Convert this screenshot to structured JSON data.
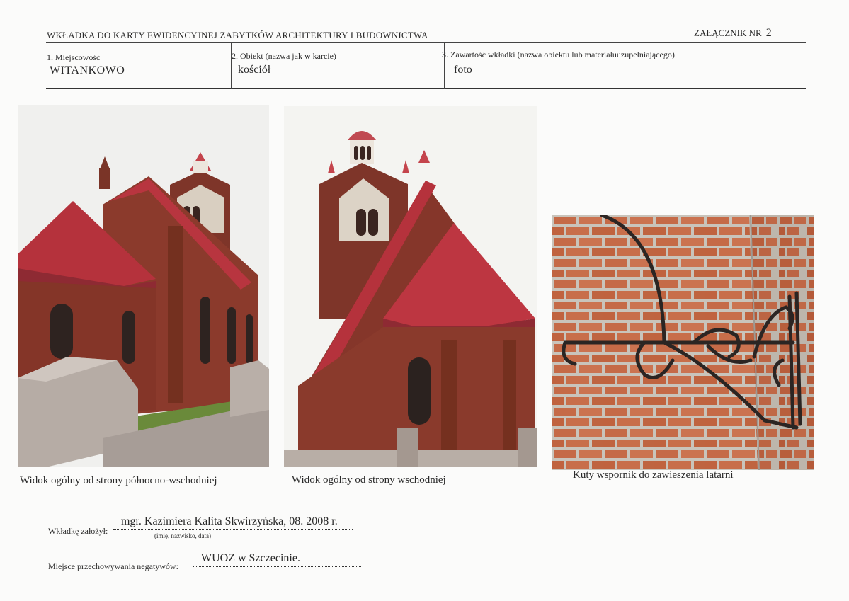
{
  "header": {
    "title": "WKŁADKA DO KARTY EWIDENCYJNEJ ZABYTKÓW ARCHITEKTURY I BUDOWNICTWA",
    "annex_label": "ZAŁĄCZNIK NR",
    "annex_number": "2"
  },
  "fields": [
    {
      "label": "1. Miejscowość",
      "value": "WITANKOWO"
    },
    {
      "label": "2. Obiekt (nazwa jak w karcie)",
      "value": "kościół"
    },
    {
      "label": "3. Zawartość wkładki (nazwa obiektu lub materiałuuzupełniającego)",
      "value": "foto"
    }
  ],
  "photos": [
    {
      "caption": "Widok ogólny od strony północno-wschodniej"
    },
    {
      "caption": "Widok ogólny od strony wschodniej"
    },
    {
      "caption": "Kuty wspornik do zawieszenia latarni"
    }
  ],
  "footer": {
    "author_label": "Wkładkę założył:",
    "author_value": "mgr. Kazimiera Kalita Skwirzyńska, 08. 2008 r.",
    "author_hint": "(imię, nazwisko, data)",
    "negatives_label": "Miejsce przechowywania negatywów:",
    "negatives_value": "WUOZ w Szczecinie."
  },
  "colors": {
    "brick": "#8a3a2c",
    "roof": "#b5323c",
    "sky": "#f2f2ef",
    "mortar": "#c9c4bb",
    "wall_brick": "#c56a47",
    "iron": "#2b2523"
  }
}
